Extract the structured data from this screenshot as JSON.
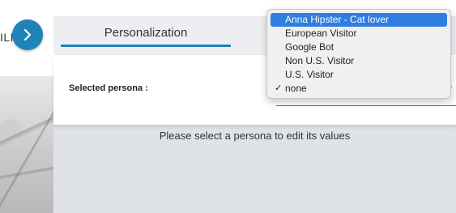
{
  "left": {
    "partial_text": "ILI"
  },
  "header": {
    "tab_label": "Personalization"
  },
  "persona": {
    "label": "Selected persona :",
    "selected": "none",
    "options": [
      "Anna Hipster - Cat lover",
      "European Visitor",
      "Google Bot",
      "Non U.S. Visitor",
      "U.S. Visitor",
      "none"
    ],
    "highlighted": "Anna Hipster - Cat lover"
  },
  "main": {
    "helper_text": "Please select a persona to edit its values"
  },
  "icons": {
    "expand": "chevron-right-icon",
    "check": "checkmark-icon",
    "dropdown_arrow": "chevron-down-icon"
  },
  "colors": {
    "accent": "#1f83b8",
    "highlight": "#2f7de1",
    "panel_bg": "#ffffff",
    "page_bg": "#dfe3e8"
  }
}
